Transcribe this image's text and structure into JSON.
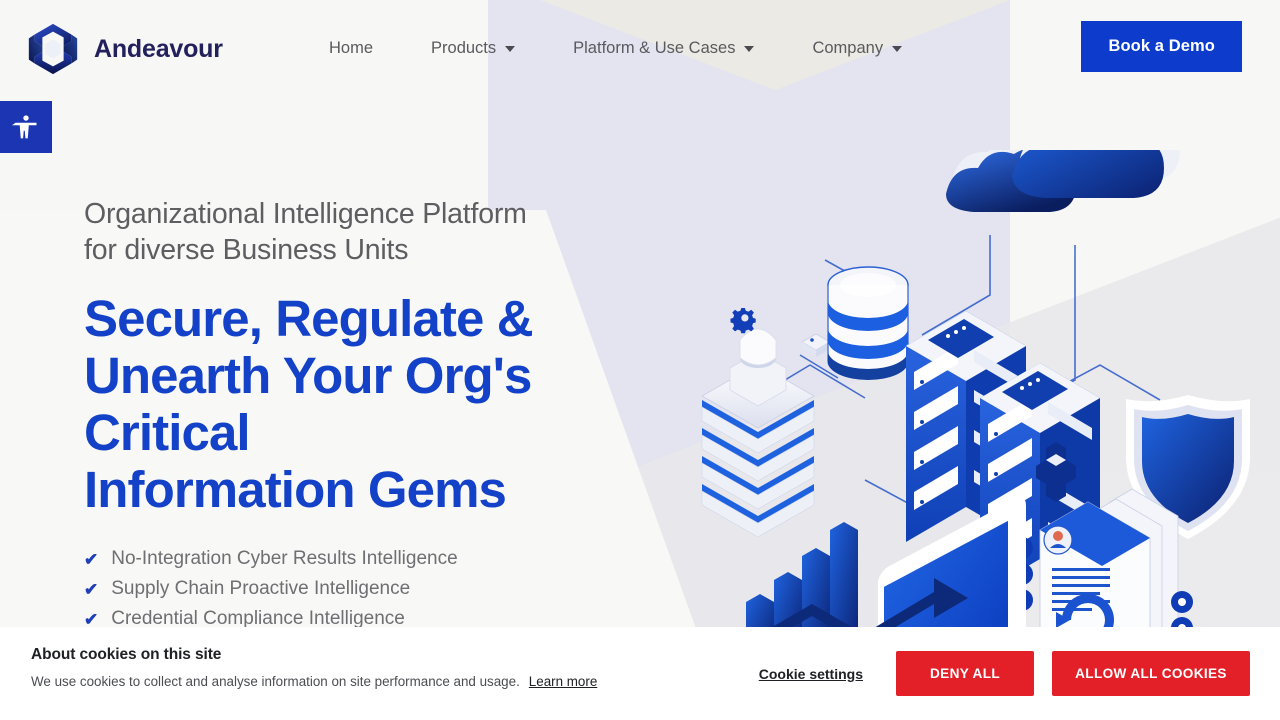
{
  "brand": {
    "name": "Andeavour",
    "logo_icon": "hexagon-cube-logo-icon",
    "brand_color": "#1341c8",
    "brand_dark": "#23215c"
  },
  "nav": {
    "items": [
      {
        "label": "Home",
        "has_dropdown": false
      },
      {
        "label": "Products",
        "has_dropdown": true
      },
      {
        "label": "Platform & Use Cases",
        "has_dropdown": true
      },
      {
        "label": "Company",
        "has_dropdown": true
      }
    ],
    "cta": {
      "label": "Book a Demo",
      "color": "#0d3ccd"
    }
  },
  "accessibility": {
    "icon": "accessibility-person-icon",
    "color": "#1b35b3"
  },
  "hero": {
    "eyebrow_line1": "Organizational Intelligence Platform",
    "eyebrow_line2": "for diverse Business Units",
    "headline_line1": "Secure, Regulate &",
    "headline_line2": "Unearth Your Org's",
    "headline_line3": "Critical",
    "headline_line4": "Information Gems",
    "bullets": [
      "No-Integration Cyber Results Intelligence",
      "Supply Chain Proactive Intelligence",
      "Credential Compliance Intelligence"
    ],
    "check_icon": "check-mark-icon"
  },
  "illustration": {
    "name": "isometric-cloud-infrastructure-illustration",
    "elements": [
      "cloud",
      "cloud",
      "database-cylinder",
      "server-rack",
      "server-rack",
      "shield",
      "document-stack",
      "bar-chart",
      "arrow-up",
      "gear",
      "stacked-layers"
    ],
    "primary": "#1353d6",
    "dark": "#0c1f63"
  },
  "cookie_banner": {
    "title": "About cookies on this site",
    "description": "We use cookies to collect and analyse information on site performance and usage.",
    "learn_more": "Learn more",
    "settings_label": "Cookie settings",
    "deny_label": "DENY ALL",
    "allow_label": "ALLOW ALL COOKIES",
    "button_color": "#e32028"
  }
}
